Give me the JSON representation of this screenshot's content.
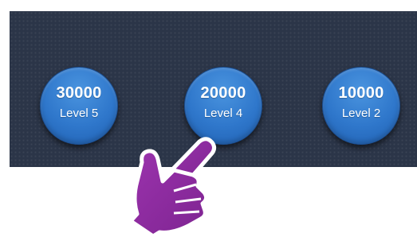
{
  "level_buttons": [
    {
      "amount": "30000",
      "level": "Level 5"
    },
    {
      "amount": "20000",
      "level": "Level 4"
    },
    {
      "amount": "10000",
      "level": "Level 2"
    }
  ],
  "colors": {
    "panel_background": "#2b3548",
    "button_fill": "#2f77cb",
    "button_text": "#ffffff",
    "pointer_hand": "#8e2ca0"
  },
  "icons": {
    "pointer": "pointing-hand-icon"
  }
}
